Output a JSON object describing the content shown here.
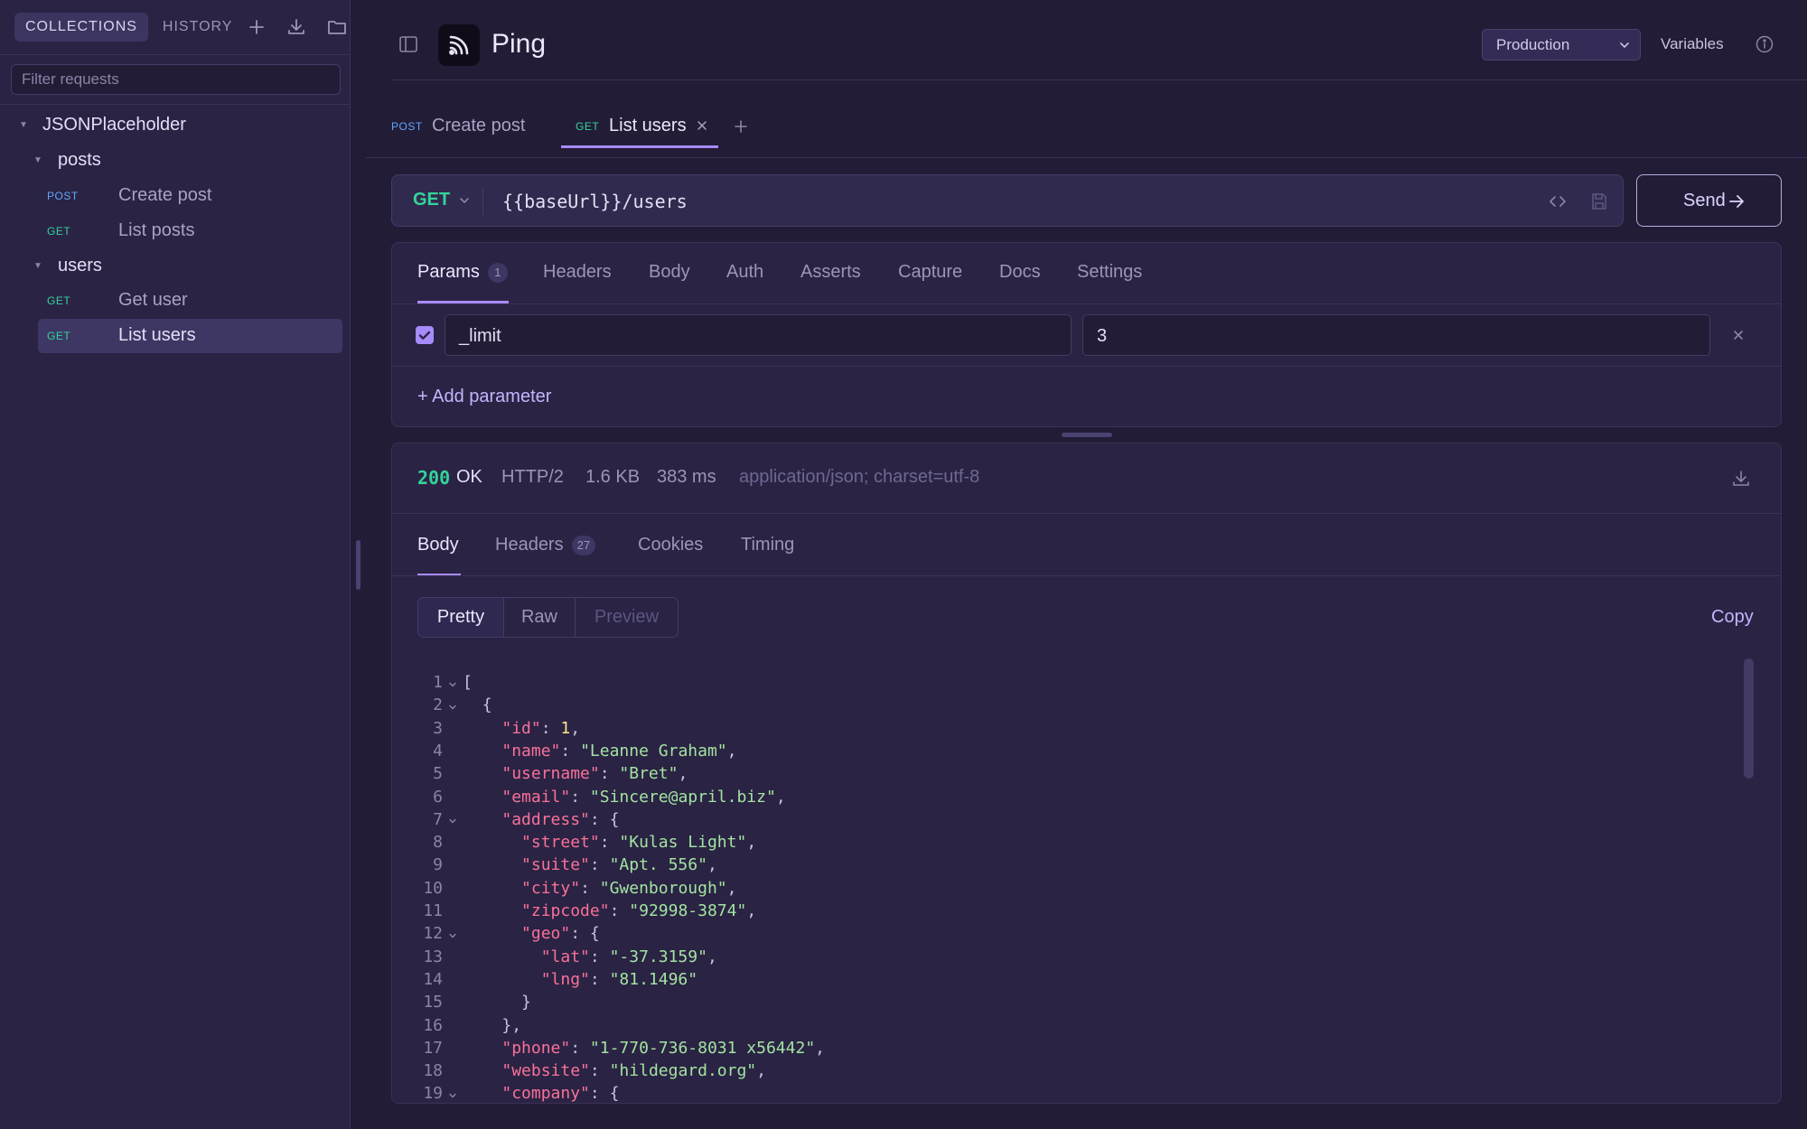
{
  "sidebar": {
    "tabs": [
      {
        "label": "COLLECTIONS"
      },
      {
        "label": "HISTORY"
      }
    ],
    "icons": [
      "plus-icon",
      "import-icon",
      "folder-icon"
    ],
    "filter_placeholder": "Filter requests",
    "collection": "JSONPlaceholder",
    "groups": [
      {
        "name": "posts",
        "requests": [
          {
            "method": "POST",
            "name": "Create post"
          },
          {
            "method": "GET",
            "name": "List posts"
          }
        ]
      },
      {
        "name": "users",
        "requests": [
          {
            "method": "GET",
            "name": "Get user"
          },
          {
            "method": "GET",
            "name": "List users",
            "selected": true
          }
        ]
      }
    ]
  },
  "header": {
    "title": "Ping",
    "environment": "Production",
    "variables_label": "Variables"
  },
  "tabs": [
    {
      "method": "POST",
      "label": "Create post"
    },
    {
      "method": "GET",
      "label": "List users",
      "active": true
    }
  ],
  "request": {
    "method": "GET",
    "url": "{{baseUrl}}/users",
    "send_label": "Send"
  },
  "request_tabs": [
    {
      "label": "Params",
      "badge": "1",
      "active": true
    },
    {
      "label": "Headers"
    },
    {
      "label": "Body"
    },
    {
      "label": "Auth"
    },
    {
      "label": "Asserts"
    },
    {
      "label": "Capture"
    },
    {
      "label": "Docs"
    },
    {
      "label": "Settings"
    }
  ],
  "params": [
    {
      "enabled": true,
      "key": "_limit",
      "value": "3"
    }
  ],
  "add_param_label": "+ Add parameter",
  "response": {
    "status_code": "200",
    "status_text": "OK",
    "protocol": "HTTP/2",
    "size": "1.6 KB",
    "time": "383 ms",
    "content_type": "application/json; charset=utf-8",
    "tabs": [
      {
        "label": "Body",
        "active": true
      },
      {
        "label": "Headers",
        "badge": "27"
      },
      {
        "label": "Cookies"
      },
      {
        "label": "Timing"
      }
    ],
    "view_modes": [
      {
        "label": "Pretty",
        "active": true
      },
      {
        "label": "Raw"
      },
      {
        "label": "Preview",
        "disabled": true
      }
    ],
    "copy_label": "Copy",
    "lines": [
      {
        "n": "1",
        "fold": true,
        "indent": 0,
        "tokens": [
          [
            "p",
            "["
          ]
        ]
      },
      {
        "n": "2",
        "fold": true,
        "indent": 1,
        "tokens": [
          [
            "p",
            "{"
          ]
        ]
      },
      {
        "n": "3",
        "fold": false,
        "indent": 2,
        "tokens": [
          [
            "k",
            "\"id\""
          ],
          [
            "p",
            ": "
          ],
          [
            "n",
            "1"
          ],
          [
            "p",
            ","
          ]
        ]
      },
      {
        "n": "4",
        "fold": false,
        "indent": 2,
        "tokens": [
          [
            "k",
            "\"name\""
          ],
          [
            "p",
            ": "
          ],
          [
            "s",
            "\"Leanne Graham\""
          ],
          [
            "p",
            ","
          ]
        ]
      },
      {
        "n": "5",
        "fold": false,
        "indent": 2,
        "tokens": [
          [
            "k",
            "\"username\""
          ],
          [
            "p",
            ": "
          ],
          [
            "s",
            "\"Bret\""
          ],
          [
            "p",
            ","
          ]
        ]
      },
      {
        "n": "6",
        "fold": false,
        "indent": 2,
        "tokens": [
          [
            "k",
            "\"email\""
          ],
          [
            "p",
            ": "
          ],
          [
            "s",
            "\"Sincere@april.biz\""
          ],
          [
            "p",
            ","
          ]
        ]
      },
      {
        "n": "7",
        "fold": true,
        "indent": 2,
        "tokens": [
          [
            "k",
            "\"address\""
          ],
          [
            "p",
            ": {"
          ]
        ]
      },
      {
        "n": "8",
        "fold": false,
        "indent": 3,
        "tokens": [
          [
            "k",
            "\"street\""
          ],
          [
            "p",
            ": "
          ],
          [
            "s",
            "\"Kulas Light\""
          ],
          [
            "p",
            ","
          ]
        ]
      },
      {
        "n": "9",
        "fold": false,
        "indent": 3,
        "tokens": [
          [
            "k",
            "\"suite\""
          ],
          [
            "p",
            ": "
          ],
          [
            "s",
            "\"Apt. 556\""
          ],
          [
            "p",
            ","
          ]
        ]
      },
      {
        "n": "10",
        "fold": false,
        "indent": 3,
        "tokens": [
          [
            "k",
            "\"city\""
          ],
          [
            "p",
            ": "
          ],
          [
            "s",
            "\"Gwenborough\""
          ],
          [
            "p",
            ","
          ]
        ]
      },
      {
        "n": "11",
        "fold": false,
        "indent": 3,
        "tokens": [
          [
            "k",
            "\"zipcode\""
          ],
          [
            "p",
            ": "
          ],
          [
            "s",
            "\"92998-3874\""
          ],
          [
            "p",
            ","
          ]
        ]
      },
      {
        "n": "12",
        "fold": true,
        "indent": 3,
        "tokens": [
          [
            "k",
            "\"geo\""
          ],
          [
            "p",
            ": {"
          ]
        ]
      },
      {
        "n": "13",
        "fold": false,
        "indent": 4,
        "tokens": [
          [
            "k",
            "\"lat\""
          ],
          [
            "p",
            ": "
          ],
          [
            "s",
            "\"-37.3159\""
          ],
          [
            "p",
            ","
          ]
        ]
      },
      {
        "n": "14",
        "fold": false,
        "indent": 4,
        "tokens": [
          [
            "k",
            "\"lng\""
          ],
          [
            "p",
            ": "
          ],
          [
            "s",
            "\"81.1496\""
          ]
        ]
      },
      {
        "n": "15",
        "fold": false,
        "indent": 3,
        "tokens": [
          [
            "p",
            "}"
          ]
        ]
      },
      {
        "n": "16",
        "fold": false,
        "indent": 2,
        "tokens": [
          [
            "p",
            "},"
          ]
        ]
      },
      {
        "n": "17",
        "fold": false,
        "indent": 2,
        "tokens": [
          [
            "k",
            "\"phone\""
          ],
          [
            "p",
            ": "
          ],
          [
            "s",
            "\"1-770-736-8031 x56442\""
          ],
          [
            "p",
            ","
          ]
        ]
      },
      {
        "n": "18",
        "fold": false,
        "indent": 2,
        "tokens": [
          [
            "k",
            "\"website\""
          ],
          [
            "p",
            ": "
          ],
          [
            "s",
            "\"hildegard.org\""
          ],
          [
            "p",
            ","
          ]
        ]
      },
      {
        "n": "19",
        "fold": true,
        "indent": 2,
        "tokens": [
          [
            "k",
            "\"company\""
          ],
          [
            "p",
            ": {"
          ]
        ]
      }
    ]
  },
  "colors": {
    "accent": "#a78bfa",
    "get": "#34d399",
    "post": "#60a5fa",
    "json_key": "#f87198",
    "json_string": "#a3e3a0",
    "json_number": "#fde68a"
  }
}
